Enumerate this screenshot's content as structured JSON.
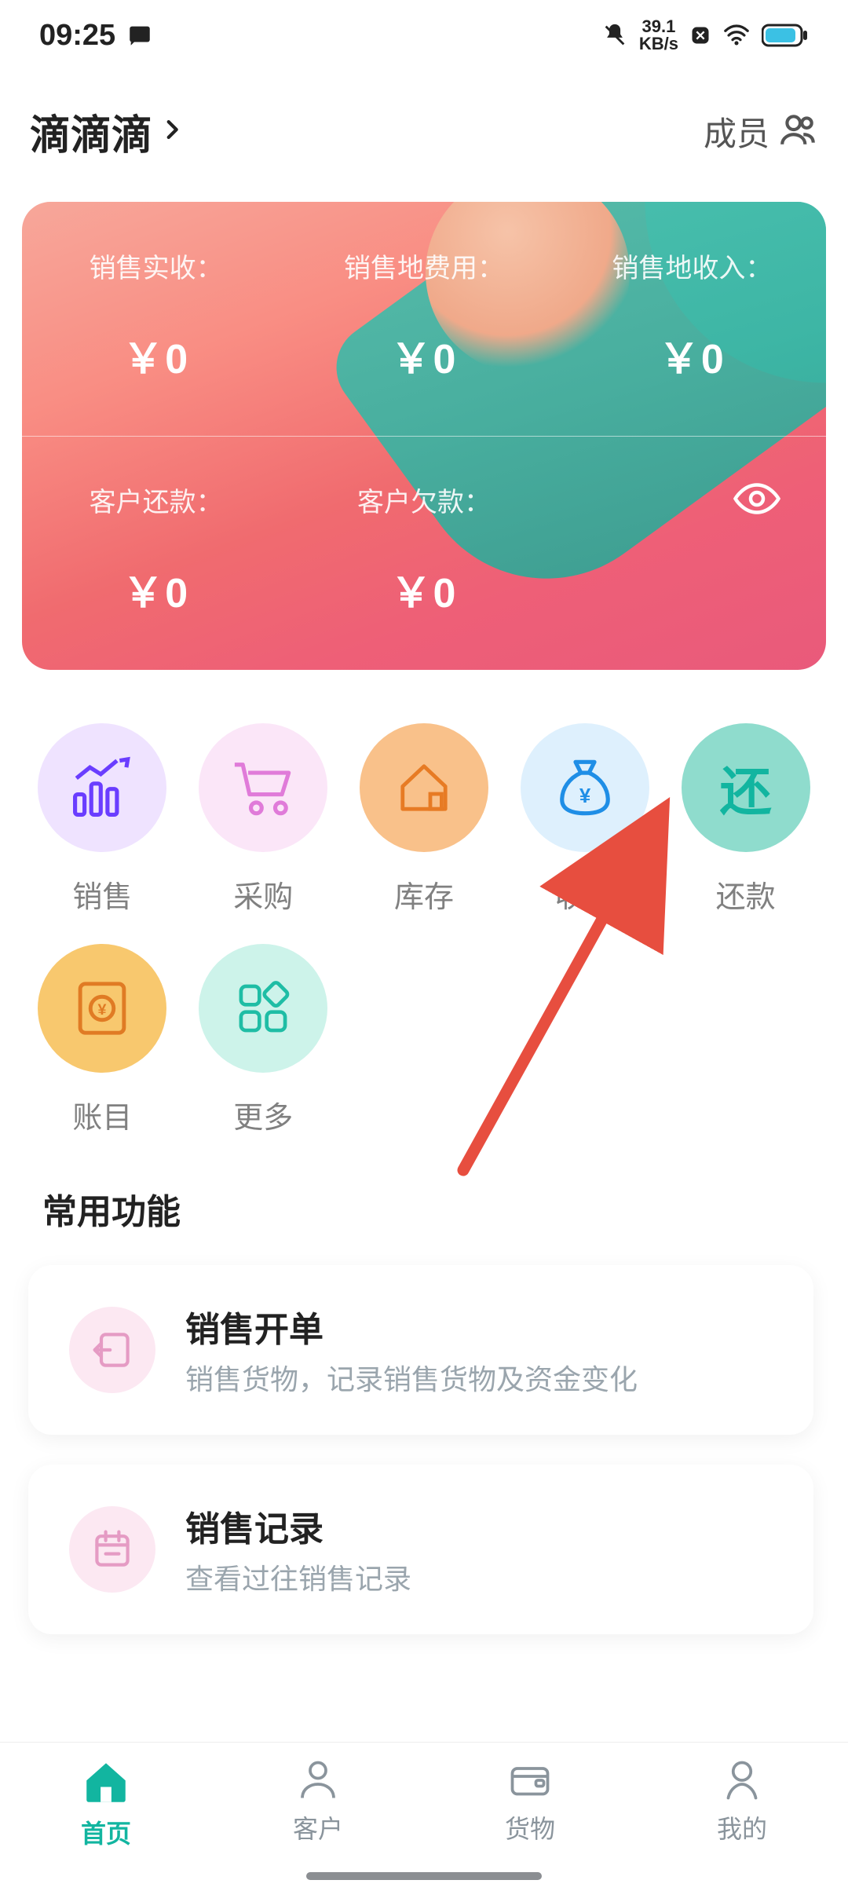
{
  "status": {
    "time": "09:25",
    "net_speed": "39.1",
    "net_unit": "KB/s"
  },
  "header": {
    "title": "滴滴滴",
    "members_label": "成员"
  },
  "dashboard": {
    "visibility_icon": "eye-icon",
    "metrics": [
      {
        "label": "销售实收：",
        "value": "￥0"
      },
      {
        "label": "销售地费用：",
        "value": "￥0"
      },
      {
        "label": "销售地收入：",
        "value": "￥0"
      },
      {
        "label": "客户还款：",
        "value": "￥0"
      },
      {
        "label": "客户欠款：",
        "value": "￥0"
      }
    ]
  },
  "features": [
    {
      "id": "sales",
      "label": "销售",
      "icon": "chart-up-icon",
      "bg": "bg-purple",
      "color": "#6a3dff"
    },
    {
      "id": "purchase",
      "label": "采购",
      "icon": "cart-icon",
      "bg": "bg-pink",
      "color": "#e07bd9"
    },
    {
      "id": "inventory",
      "label": "库存",
      "icon": "house-icon",
      "bg": "bg-orange",
      "color": "#e77b24"
    },
    {
      "id": "finance",
      "label": "收支",
      "icon": "money-bag-icon",
      "bg": "bg-blue",
      "color": "#1f8ee6"
    },
    {
      "id": "repay",
      "label": "还款",
      "icon": "repay-glyph",
      "bg": "bg-teal",
      "color": "#12b5a0",
      "glyph": "还"
    },
    {
      "id": "ledger",
      "label": "账目",
      "icon": "ledger-icon",
      "bg": "bg-yellow",
      "color": "#e07b24"
    },
    {
      "id": "more",
      "label": "更多",
      "icon": "apps-icon",
      "bg": "bg-mint",
      "color": "#1fbda5"
    }
  ],
  "section": {
    "title": "常用功能"
  },
  "funcs": [
    {
      "id": "sale-order",
      "title": "销售开单",
      "desc": "销售货物，记录销售货物及资金变化",
      "icon": "export-icon"
    },
    {
      "id": "sale-record",
      "title": "销售记录",
      "desc": "查看过往销售记录",
      "icon": "calendar-icon"
    }
  ],
  "bottom_nav": [
    {
      "id": "home",
      "label": "首页",
      "icon": "home-icon",
      "active": true
    },
    {
      "id": "customer",
      "label": "客户",
      "icon": "person-icon",
      "active": false
    },
    {
      "id": "goods",
      "label": "货物",
      "icon": "wallet-icon",
      "active": false
    },
    {
      "id": "mine",
      "label": "我的",
      "icon": "user-icon",
      "active": false
    }
  ],
  "colors": {
    "accent": "#12b5a0",
    "text_muted": "#8a949c"
  }
}
